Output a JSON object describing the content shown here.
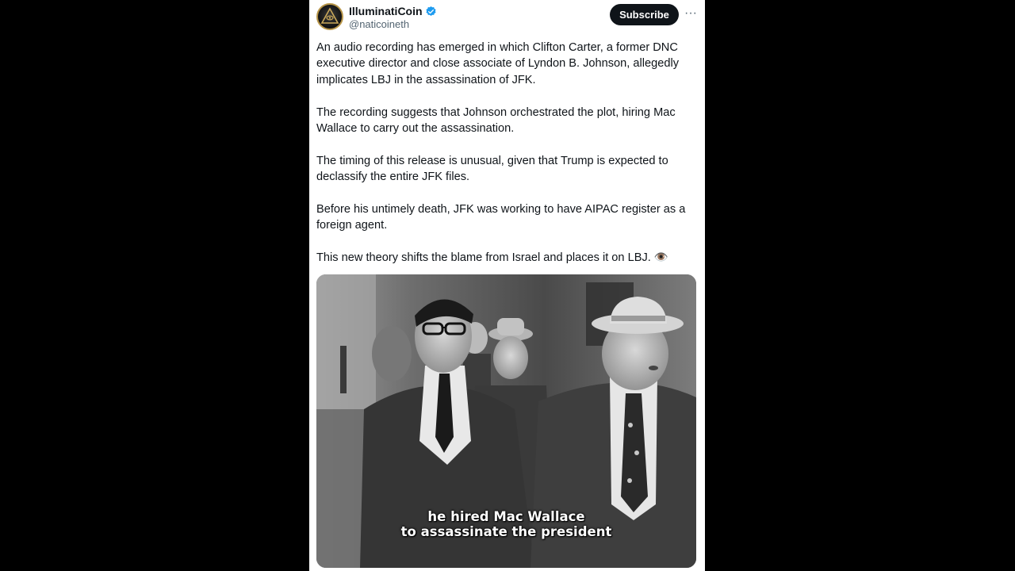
{
  "post": {
    "author": {
      "display_name": "IlluminatiCoin",
      "handle": "@naticoineth",
      "verified": true,
      "avatar_icon": "eye-pyramid-logo"
    },
    "actions": {
      "subscribe_label": "Subscribe",
      "more_icon": "more-horizontal-icon",
      "more_glyph": "···"
    },
    "paragraphs": [
      "An audio recording has emerged in which Clifton Carter, a former DNC executive director and close associate of Lyndon B. Johnson, allegedly implicates LBJ in the assassination of JFK.",
      "The recording suggests that Johnson orchestrated the plot, hiring Mac Wallace to carry out the assassination.",
      "The timing of this release is unusual, given that Trump is expected to declassify the entire JFK files.",
      "Before his untimely death, JFK was working to have AIPAC register as a foreign agent.",
      "This new theory shifts the blame from Israel and places it on LBJ. 👁️"
    ],
    "media": {
      "caption_line1": "he hired Mac Wallace",
      "caption_line2": "to assassinate the president"
    }
  },
  "colors": {
    "background": "#000000",
    "card": "#ffffff",
    "text": "#0f1419",
    "secondary_text": "#536471",
    "verified_blue": "#1d9bf0",
    "subscribe_bg": "#0f1419"
  }
}
